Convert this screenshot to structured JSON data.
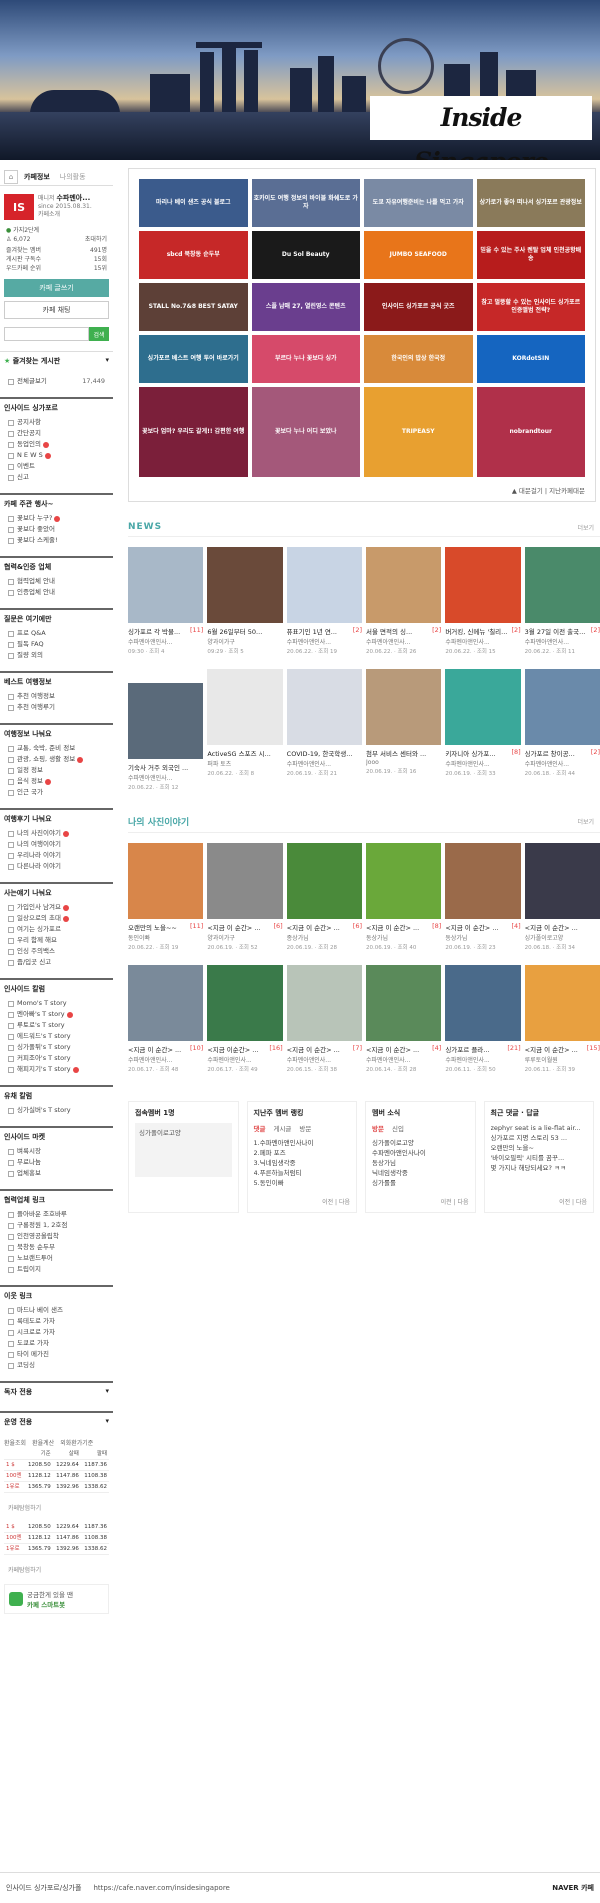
{
  "banner": {
    "title": "Inside Singapore"
  },
  "sidebar": {
    "tabs": {
      "home_icon": "home-icon",
      "cafe_info": "카페정보",
      "my_activity": "나의활동"
    },
    "cafe": {
      "logo": "IS",
      "manager_label": "매니저",
      "manager_name": "수파멘아...",
      "since": "since 2015.08.31.",
      "intro": "카페소개"
    },
    "grade": {
      "level": "가지2단계",
      "members": "6,072",
      "invite": "초대하기"
    },
    "stats": [
      {
        "label": "즐겨찾는 멤버",
        "value": "491명"
      },
      {
        "label": "게시판 구독수",
        "value": "15회"
      },
      {
        "label": "우드카페 순위",
        "value": "15위"
      }
    ],
    "join_button": "카페 글쓰기",
    "chat_button": "카페 채팅",
    "search_button": "검색",
    "favorites_title": "즐겨찾는 게시판",
    "all_posts": {
      "label": "전체글보기",
      "count": "17,449"
    },
    "sections": [
      {
        "title": "인사이드 싱가포르",
        "items": [
          {
            "label": "공지사항",
            "new": false
          },
          {
            "label": "간단공지",
            "new": false
          },
          {
            "label": "동업인의",
            "new": true
          },
          {
            "label": "N E W S",
            "new": true
          },
          {
            "label": "이벤트",
            "new": false
          },
          {
            "label": "신고",
            "new": false
          }
        ]
      },
      {
        "title": "카페 주관 행사~",
        "items": [
          {
            "label": "꽃보다 누구?",
            "new": true
          },
          {
            "label": "꽃보다 좋았어",
            "new": false
          },
          {
            "label": "꽃보다 스케줄!",
            "new": false
          }
        ]
      },
      {
        "title": "협력&인증 업체",
        "items": [
          {
            "label": "협력업체 안내",
            "new": false
          },
          {
            "label": "인증업체 안내",
            "new": false
          }
        ]
      },
      {
        "title": "질문은 여기에만",
        "items": [
          {
            "label": "프로 Q&A",
            "new": false
          },
          {
            "label": "필독 FAQ",
            "new": false
          },
          {
            "label": "질량 외의",
            "new": false
          }
        ]
      },
      {
        "title": "베스트 여행정보",
        "items": [
          {
            "label": "추천 여행정보",
            "new": false
          },
          {
            "label": "추천 여행루기",
            "new": false
          }
        ]
      },
      {
        "title": "여행정보 나눠요",
        "items": [
          {
            "label": "교통, 숙박, 준비 정보",
            "new": false
          },
          {
            "label": "관광, 쇼핑, 생활 정보",
            "new": true
          },
          {
            "label": "일정 정보",
            "new": false
          },
          {
            "label": "음식 정보",
            "new": true
          },
          {
            "label": "인근 국가",
            "new": false
          }
        ]
      },
      {
        "title": "여행후기 나눠요",
        "items": [
          {
            "label": "나의 사진이야기",
            "new": true
          },
          {
            "label": "나의 여행이야기",
            "new": false
          },
          {
            "label": "우리나라 이야기",
            "new": false
          },
          {
            "label": "다른나라 이야기",
            "new": false
          }
        ]
      },
      {
        "title": "사는얘기 나눠요",
        "items": [
          {
            "label": "가입인사 남겨요",
            "new": true
          },
          {
            "label": "일상으로의 초대",
            "new": true
          },
          {
            "label": "여기는 싱가포르",
            "new": false
          },
          {
            "label": "우리 함께 해요",
            "new": false
          },
          {
            "label": "인싱 주의백스",
            "new": false
          },
          {
            "label": "줍/입곳 신고",
            "new": false
          }
        ]
      },
      {
        "title": "인사이드 칼럼",
        "items": [
          {
            "label": "Momo's T story",
            "new": false
          },
          {
            "label": "멘아빠's T story",
            "new": true
          },
          {
            "label": "루토로's T story",
            "new": false
          },
          {
            "label": "에드워드's T story",
            "new": false
          },
          {
            "label": "싱가폴튀's T story",
            "new": false
          },
          {
            "label": "커피조아's T story",
            "new": false
          },
          {
            "label": "해피지기's T story",
            "new": true
          }
        ]
      },
      {
        "title": "유채 칼럼",
        "items": [
          {
            "label": "싱가실버's T story",
            "new": false
          }
        ]
      },
      {
        "title": "인사이드 마켓",
        "items": [
          {
            "label": "벼룩시장",
            "new": false
          },
          {
            "label": "무료나눔",
            "new": false
          },
          {
            "label": "업체홍보",
            "new": false
          }
        ]
      },
      {
        "title": "협력업체 링크",
        "items": [
          {
            "label": "플아바운 조호바루",
            "new": false
          },
          {
            "label": "구룡정원 1, 2호점",
            "new": false
          },
          {
            "label": "인천영공올립착",
            "new": false
          },
          {
            "label": "북창동 순두부",
            "new": false
          },
          {
            "label": "노브랜드투어",
            "new": false
          },
          {
            "label": "트립이지",
            "new": false
          }
        ]
      },
      {
        "title": "이웃 링크",
        "items": [
          {
            "label": "마드나 베이 샌즈",
            "new": false
          },
          {
            "label": "룩테도로 가자",
            "new": false
          },
          {
            "label": "시크로로 가자",
            "new": false
          },
          {
            "label": "도쿄로 가자",
            "new": false
          },
          {
            "label": "타이 메가진",
            "new": false
          },
          {
            "label": "코딩싱",
            "new": false
          }
        ]
      }
    ],
    "collapsed": [
      "독자 전용",
      "운영 전용"
    ],
    "rates": {
      "tabs": [
        "환율조회",
        "환율계산",
        "외화환가기준"
      ],
      "headers": [
        "",
        "기준",
        "살때",
        "팔때"
      ],
      "rows": [
        [
          "1 $",
          "1208.50",
          "1229.64",
          "1187.36"
        ],
        [
          "100엔",
          "1128.12",
          "1147.86",
          "1108.38"
        ],
        [
          "1유로",
          "1365.79",
          "1392.96",
          "1338.62"
        ]
      ],
      "caption": "카페탐험하기"
    },
    "rates2": {
      "rows": [
        [
          "1 $",
          "1208.50",
          "1229.64",
          "1187.36"
        ],
        [
          "100엔",
          "1128.12",
          "1147.86",
          "1108.38"
        ],
        [
          "1유로",
          "1365.79",
          "1392.96",
          "1338.62"
        ]
      ],
      "caption": "카페탐험하기"
    },
    "help": {
      "line1": "궁금한게 있을 땐",
      "line2": "카페 스마트봇"
    }
  },
  "board": {
    "ads": [
      {
        "text": "마리나 베이 샌즈 공식 블로그",
        "color": "#3b5b8c"
      },
      {
        "text": "호카이도 여행 정보의 바이블 화쉐도로 가자",
        "color": "#5a6e94"
      },
      {
        "text": "도쿄 자유여행준비는 나를 먹고 가자",
        "color": "#7a8aa4"
      },
      {
        "text": "상가로가 좋아 떠나서 싱가포르 관광정보",
        "color": "#8a7a5a"
      },
      {
        "text": "sbcd 북창동 순두부",
        "color": "#c62828"
      },
      {
        "text": "Du Sol Beauty",
        "color": "#1a1a1a"
      },
      {
        "text": "JUMBO SEAFOOD",
        "color": "#e8751a"
      },
      {
        "text": "믿을 수 있는 주사 렌탈 업체 인천공항배송",
        "color": "#b71c1c"
      },
      {
        "text": "STALL No.7&8 BEST SATAY",
        "color": "#5d4037"
      },
      {
        "text": "스플 남매 27, 열린영스 콘텐츠",
        "color": "#6a3e8e"
      },
      {
        "text": "인사이드 싱가포르 공식 굿즈",
        "color": "#8b1a1a"
      },
      {
        "text": "참고 멀뚱할 수 있는 인사이드 싱가포르 인증앨범 전략?",
        "color": "#c62828"
      },
      {
        "text": "싱가포르 베스트 여행 투어 바로가기",
        "color": "#2e6e8e"
      },
      {
        "text": "부르다 누나 꽃보다 싱가",
        "color": "#d64a6a"
      },
      {
        "text": "한국인의 밥상 한국정",
        "color": "#d88a3a"
      },
      {
        "text": "KORdotSIN",
        "color": "#1565c0"
      },
      {
        "text": "꽃보다 엄마? 우리도 갈게!! 감편한 여행",
        "color": "#7b1f3a"
      },
      {
        "text": "꽃보다 누나 어디 보았나",
        "color": "#a4587a"
      },
      {
        "text": "TRIPEASY",
        "color": "#e8a030"
      },
      {
        "text": "nobrandtour",
        "color": "#b0304a"
      }
    ],
    "footer": "▲ 대문걸기 | 지난카페대문"
  },
  "news": {
    "title": "NEWS",
    "more": "더보기",
    "items": [
      {
        "title": "싱가포르 각 박물...",
        "comments": "[11]",
        "author": "수파멘아앤인사...",
        "date": "09:30 · 조회 4",
        "color": "#a8b8c8"
      },
      {
        "title": "6월 26일부터 50...",
        "comments": "",
        "author": "양과이가구",
        "date": "09:29 · 조회 5",
        "color": "#6a4a3a"
      },
      {
        "title": "퓨표기인 1년 연...",
        "comments": "[2]",
        "author": "수파멘아앤인사...",
        "date": "20.06.22. · 조회 19",
        "color": "#c8d4e4"
      },
      {
        "title": "서울 면적의 싱...",
        "comments": "[2]",
        "author": "수파멘아앤인사...",
        "date": "20.06.22. · 조회 26",
        "color": "#c89a6a"
      },
      {
        "title": "버거킹, 신메뉴 '칠리...",
        "comments": "[2]",
        "author": "수파멘아앤인사...",
        "date": "20.06.22. · 조회 15",
        "color": "#d84a2a"
      },
      {
        "title": "3월 27일 이전 출국...",
        "comments": "[2]",
        "author": "수파멘아앤인사...",
        "date": "20.06.22. · 조회 11",
        "color": "#4a8a6a"
      },
      {
        "title": "기숙사 거주 외국인 ...",
        "comments": "",
        "author": "수파멘아앤인사...",
        "date": "20.06.22. · 조회 12",
        "color": "#5a6a7a"
      },
      {
        "title": "ActiveSG 스포즈 시...",
        "comments": "",
        "author": "퍼파 토츠",
        "date": "20.06.22. · 조회 8",
        "color": "#e8e8e8"
      },
      {
        "title": "COVID-19, 한국학생...",
        "comments": "",
        "author": "수파멘아앤인사...",
        "date": "20.06.19. · 조회 21",
        "color": "#d8dce4"
      },
      {
        "title": "첨부 서비스 센터와 ...",
        "comments": "",
        "author": "Jooo",
        "date": "20.06.19. · 조회 16",
        "color": "#b89a7a"
      },
      {
        "title": "키자니아 싱가포...",
        "comments": "[8]",
        "author": "수파멘아앤인사...",
        "date": "20.06.19. · 조회 33",
        "color": "#3aa89a"
      },
      {
        "title": "싱가포르 창이공...",
        "comments": "[2]",
        "author": "수파멘아앤인사...",
        "date": "20.06.18. · 조회 44",
        "color": "#6a8aaa"
      }
    ]
  },
  "photos": {
    "title": "나의 사진이야기",
    "more": "더보기",
    "items": [
      {
        "title": "오랜만의 노을~~",
        "comments": "[11]",
        "author": "동인이빠",
        "date": "20.06.22. · 조회 19",
        "color": "#d8864a"
      },
      {
        "title": "<지금 이 순간> ...",
        "comments": "[6]",
        "author": "양과이가구",
        "date": "20.06.19. · 조회 52",
        "color": "#8a8a8a"
      },
      {
        "title": "<지금 이 순간> ...",
        "comments": "[6]",
        "author": "종상가님",
        "date": "20.06.19. · 조회 28",
        "color": "#4a8a3a"
      },
      {
        "title": "<지금 이 순간> ...",
        "comments": "[8]",
        "author": "동상가님",
        "date": "20.06.19. · 조회 40",
        "color": "#6aa83a"
      },
      {
        "title": "<지금 이 순간> ...",
        "comments": "[4]",
        "author": "동상가님",
        "date": "20.06.19. · 조회 23",
        "color": "#9a6a4a"
      },
      {
        "title": "<지금 이 순간> ...",
        "comments": "",
        "author": "싱가폴이로고양",
        "date": "20.06.18. · 조회 34",
        "color": "#3a3a4a"
      },
      {
        "title": "<지금 이 순간> ...",
        "comments": "[10]",
        "author": "수파멘아앤인사...",
        "date": "20.06.17. · 조회 48",
        "color": "#7a8a9a"
      },
      {
        "title": "<지금 이순간> ...",
        "comments": "[16]",
        "author": "수파멘아앤인사...",
        "date": "20.06.17. · 조회 49",
        "color": "#3a7a4a"
      },
      {
        "title": "<지금 이 순간> ...",
        "comments": "[7]",
        "author": "수파멘아앤인사...",
        "date": "20.06.15. · 조회 38",
        "color": "#b8c4b8"
      },
      {
        "title": "<지금 이 순간> ...",
        "comments": "[4]",
        "author": "수파멘아앤인사...",
        "date": "20.06.14. · 조회 28",
        "color": "#5a8a5a"
      },
      {
        "title": "싱가포르 플라...",
        "comments": "[21]",
        "author": "수파멘아앤인사...",
        "date": "20.06.11. · 조회 50",
        "color": "#4a6a8a"
      },
      {
        "title": "<지금 이 순간> ...",
        "comments": "[15]",
        "author": "루루토이월원",
        "date": "20.06.11. · 조회 39",
        "color": "#e8a040"
      }
    ]
  },
  "widgets": {
    "online": {
      "title": "접속멤버 1명",
      "member": "싱가폴이로고양"
    },
    "ranking": {
      "title": "지난주 멤버 랭킹",
      "tabs": [
        "댓글",
        "게시글",
        "방문"
      ],
      "items": [
        "1.수파멘아앤인사나이",
        "2.페파 포즈",
        "3.닉네임생각중",
        "4.푸른하늘처럼티",
        "5.동인이빠"
      ],
      "prev": "이전",
      "next": "다음"
    },
    "news": {
      "title": "멤버 소식",
      "tabs": [
        "방문",
        "신입"
      ],
      "items": [
        "싱가폴이로고양",
        "수파멘아앤인사나이",
        "동상가님",
        "닉네임생각중",
        "싱가롤롤"
      ],
      "prev": "이전",
      "next": "다음"
    },
    "comments": {
      "title": "최근 댓글 · 답글",
      "items": [
        "zephyr seat is a lie-flat air...",
        "싱가포르 지명 스토리 53 ...",
        "오랜만의 노을~",
        "'바이오필릭' 시티를 꿈꾸...",
        "몇 가지나 해당되세요? ㅋㅋ"
      ],
      "prev": "이전",
      "next": "다음"
    }
  },
  "footer": {
    "name": "인사이드 싱가포르/싱가폴",
    "url": "https://cafe.naver.com/insidesingapore",
    "brand": "NAVER 카페"
  }
}
